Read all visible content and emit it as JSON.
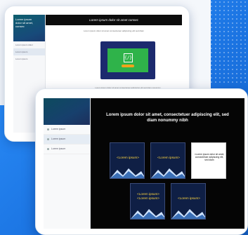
{
  "colors": {
    "accent": "#1f7fe6",
    "video_green": "#2fb34a",
    "label_yellow": "#ffd640"
  },
  "tablet_back": {
    "sidebar": {
      "header_lines": [
        "Lorem ipsum",
        "dolor sit amet,",
        "consec"
      ],
      "items": [
        "Lorem ipsum dolor",
        "Lorem ipsum",
        "Lorem ipsum"
      ]
    },
    "main": {
      "title": "Lorem ipsum dolor sit amet consec",
      "subtitle": "Lorem ipsum dolor sit amet consectetuer adipiscing elit sed diam",
      "code_glyph": "{/}",
      "caption": "Lorem ipsum dolor sit amet consectetuer adipiscing elit sed diam nonummy"
    }
  },
  "tablet_front": {
    "sidebar": {
      "items": [
        {
          "label": "Lorem ipsum",
          "icon": "dot-icon"
        },
        {
          "label": "Lorem ipsum",
          "icon": "dot-icon"
        },
        {
          "label": "Lorem ipsum",
          "icon": "dot-icon"
        }
      ]
    },
    "main": {
      "title": "Lorem ipsum dolor sit amet, consectetuer adipiscing elit, sed diam nonummy nibh",
      "cards": [
        {
          "label": "<Lorem ipsum>"
        },
        {
          "label": "<Lorem ipsum>"
        },
        {
          "label": "<Lorem ipsum dolor sit amet, consectetuer adipiscing elit, sed diam"
        },
        {
          "label": "<Lorem ipsum> <Lorem ipsum>"
        },
        {
          "label": "<Lorem ipsum>"
        }
      ]
    }
  }
}
